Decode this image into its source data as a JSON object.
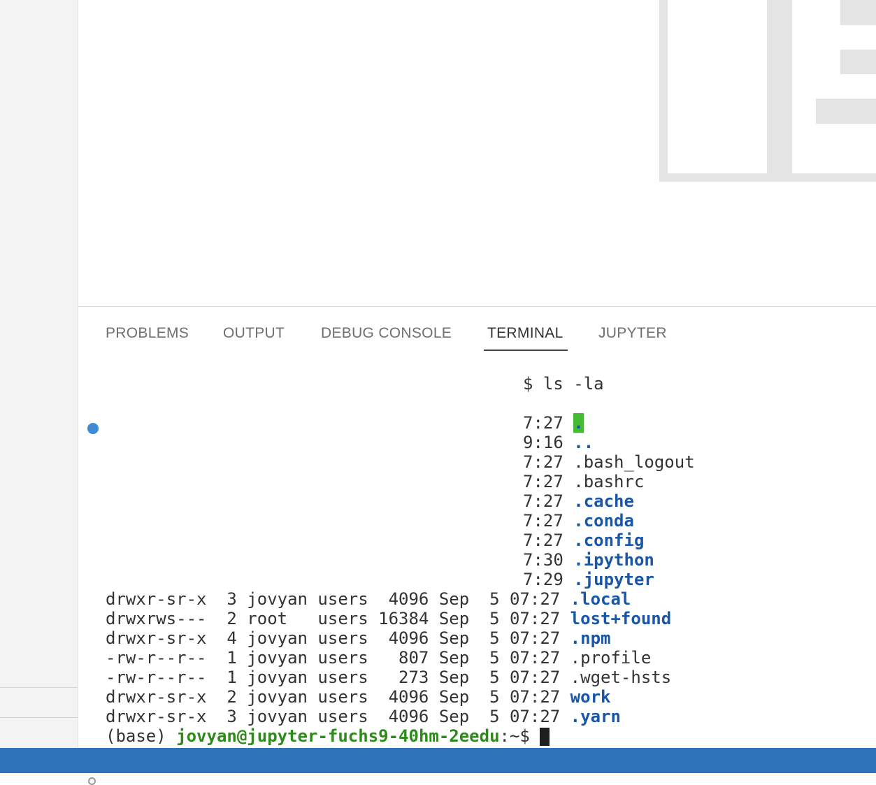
{
  "panel": {
    "tabs": [
      {
        "label": "PROBLEMS",
        "active": false
      },
      {
        "label": "OUTPUT",
        "active": false
      },
      {
        "label": "DEBUG CONSOLE",
        "active": false
      },
      {
        "label": "TERMINAL",
        "active": true
      },
      {
        "label": "JUPYTER",
        "active": false
      }
    ]
  },
  "terminal": {
    "command_fragment": "$ ls -la",
    "visible_partial_rows": [
      {
        "time": "7:27",
        "name": "."
      },
      {
        "time": "9:16",
        "name": ".."
      },
      {
        "time": "7:27",
        "name": ".bash_logout"
      },
      {
        "time": "7:27",
        "name": ".bashrc"
      },
      {
        "time": "7:27",
        "name": ".cache"
      },
      {
        "time": "7:27",
        "name": ".conda"
      },
      {
        "time": "7:27",
        "name": ".config"
      },
      {
        "time": "7:30",
        "name": ".ipython"
      },
      {
        "time": "7:29",
        "name": ".jupyter"
      }
    ],
    "rows": [
      {
        "text": "drwxr-sr-x  3 jovyan users  4096 Sep  5 07:27 ",
        "name": ".local"
      },
      {
        "text": "drwxrws---  2 root   users 16384 Sep  5 07:27 ",
        "name": "lost+found"
      },
      {
        "text": "drwxr-sr-x  4 jovyan users  4096 Sep  5 07:27 ",
        "name": ".npm"
      },
      {
        "text": "-rw-r--r--  1 jovyan users   807 Sep  5 07:27 ",
        "name": ".profile"
      },
      {
        "text": "-rw-r--r--  1 jovyan users   273 Sep  5 07:27 ",
        "name": ".wget-hsts"
      },
      {
        "text": "drwxr-sr-x  2 jovyan users  4096 Sep  5 07:27 ",
        "name": "work"
      },
      {
        "text": "drwxr-sr-x  3 jovyan users  4096 Sep  5 07:27 ",
        "name": ".yarn"
      }
    ],
    "prompt": {
      "env": "(base) ",
      "userhost": "jovyan@jupyter-fuchs9-40hm-2eedu",
      "path": ":~$ "
    }
  },
  "colors": {
    "directory": "#1a56a8",
    "userhost": "#2f8a1c",
    "statusbar": "#2e72b8",
    "highlight": "#44bb33"
  }
}
